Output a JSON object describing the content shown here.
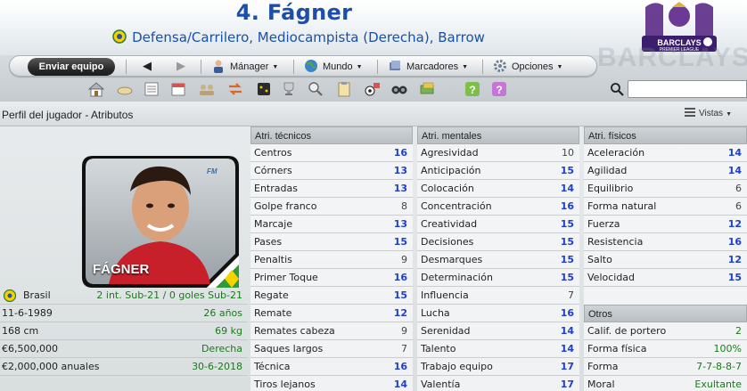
{
  "header": {
    "player_title": "4. Fágner",
    "player_subtitle": "Defensa/Carrilero, Mediocampista (Derecha), Barrow",
    "league_logo_text": "BARCLAYS",
    "league_logo_subtext": "PREMIER LEAGUE",
    "watermark": "BARCLAYS"
  },
  "toolbar": {
    "send_label": "Enviar equipo",
    "menus": [
      {
        "label": "Mánager",
        "icon": "manager-icon"
      },
      {
        "label": "Mundo",
        "icon": "globe-icon"
      },
      {
        "label": "Marcadores",
        "icon": "bookmarks-icon"
      },
      {
        "label": "Opciones",
        "icon": "options-icon"
      }
    ],
    "icons": [
      "home-icon",
      "inbox-icon",
      "news-icon",
      "calendar-icon",
      "squad-icon",
      "transfers-icon",
      "tactics-icon",
      "trophy-icon",
      "scouting-icon",
      "clipboard-icon",
      "training-icon",
      "binoculars-icon",
      "finances-icon",
      "help-icon",
      "info-icon"
    ],
    "search_placeholder": ""
  },
  "subheader": {
    "breadcrumb": "Perfil del jugador - Atributos",
    "views_label": "Vistas"
  },
  "profile": {
    "photo_name": "FÁGNER",
    "nationality": "Brasil",
    "caps": "2 int. Sub-21 / 0 goles Sub-21",
    "dob": "11-6-1989",
    "age": "26 años",
    "height": "168 cm",
    "weight": "69 kg",
    "value": "€6,500,000",
    "foot": "Derecha",
    "wage": "€2,000,000 anuales",
    "contract_end": "30-6-2018"
  },
  "technical": {
    "title": "Atri. técnicos",
    "rows": [
      {
        "name": "Centros",
        "value": "16",
        "style": "blue"
      },
      {
        "name": "Córners",
        "value": "13",
        "style": "blue"
      },
      {
        "name": "Entradas",
        "value": "13",
        "style": "blue"
      },
      {
        "name": "Golpe franco",
        "value": "8",
        "style": "grey"
      },
      {
        "name": "Marcaje",
        "value": "13",
        "style": "blue"
      },
      {
        "name": "Pases",
        "value": "15",
        "style": "blue"
      },
      {
        "name": "Penaltis",
        "value": "9",
        "style": "grey"
      },
      {
        "name": "Primer Toque",
        "value": "16",
        "style": "blue"
      },
      {
        "name": "Regate",
        "value": "15",
        "style": "blue"
      },
      {
        "name": "Remate",
        "value": "12",
        "style": "blue"
      },
      {
        "name": "Remates cabeza",
        "value": "9",
        "style": "grey"
      },
      {
        "name": "Saques largos",
        "value": "7",
        "style": "grey"
      },
      {
        "name": "Técnica",
        "value": "16",
        "style": "blue"
      },
      {
        "name": "Tiros lejanos",
        "value": "14",
        "style": "blue"
      }
    ]
  },
  "mental": {
    "title": "Atri. mentales",
    "rows": [
      {
        "name": "Agresividad",
        "value": "10",
        "style": "grey"
      },
      {
        "name": "Anticipación",
        "value": "15",
        "style": "blue"
      },
      {
        "name": "Colocación",
        "value": "14",
        "style": "blue"
      },
      {
        "name": "Concentración",
        "value": "16",
        "style": "blue"
      },
      {
        "name": "Creatividad",
        "value": "15",
        "style": "blue"
      },
      {
        "name": "Decisiones",
        "value": "15",
        "style": "blue"
      },
      {
        "name": "Desmarques",
        "value": "15",
        "style": "blue"
      },
      {
        "name": "Determinación",
        "value": "15",
        "style": "blue"
      },
      {
        "name": "Influencia",
        "value": "7",
        "style": "grey"
      },
      {
        "name": "Lucha",
        "value": "16",
        "style": "blue"
      },
      {
        "name": "Serenidad",
        "value": "14",
        "style": "blue"
      },
      {
        "name": "Talento",
        "value": "14",
        "style": "blue"
      },
      {
        "name": "Trabajo equipo",
        "value": "17",
        "style": "blue"
      },
      {
        "name": "Valentía",
        "value": "17",
        "style": "blue"
      }
    ]
  },
  "physical": {
    "title": "Atri. físicos",
    "rows": [
      {
        "name": "Aceleración",
        "value": "14",
        "style": "blue"
      },
      {
        "name": "Agilidad",
        "value": "14",
        "style": "blue"
      },
      {
        "name": "Equilibrio",
        "value": "6",
        "style": "grey"
      },
      {
        "name": "Forma natural",
        "value": "6",
        "style": "grey"
      },
      {
        "name": "Fuerza",
        "value": "12",
        "style": "blue"
      },
      {
        "name": "Resistencia",
        "value": "16",
        "style": "blue"
      },
      {
        "name": "Salto",
        "value": "12",
        "style": "blue"
      },
      {
        "name": "Velocidad",
        "value": "15",
        "style": "blue"
      }
    ]
  },
  "other": {
    "title": "Otros",
    "rows": [
      {
        "name": "Calif. de portero",
        "value": "2",
        "style": "green"
      },
      {
        "name": "Forma física",
        "value": "100%",
        "style": "green"
      },
      {
        "name": "Forma",
        "value": "7-7-8-8-7",
        "style": "green"
      },
      {
        "name": "Moral",
        "value": "Exultante",
        "style": "green"
      }
    ]
  },
  "colors": {
    "title_blue": "#1b4fa8",
    "value_blue": "#1f3fc8",
    "value_green": "#1a7a1a"
  }
}
